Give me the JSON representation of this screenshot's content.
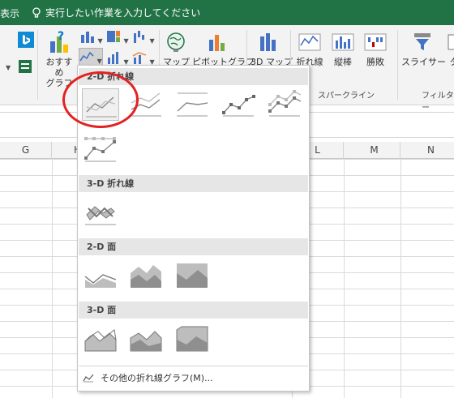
{
  "titlebar": {
    "view_tab": "表示",
    "tell_me": "実行したい作業を入力してください"
  },
  "ribbon": {
    "recommended_charts": "おすすめ\nグラフ",
    "maps": "マップ",
    "pivot_chart": "ピボットグラフ",
    "map_3d": "3D マップ",
    "sparkline_line": "折れ線",
    "sparkline_column": "縦棒",
    "sparkline_winloss": "勝敗",
    "slicer": "スライサー",
    "timeline": "タ",
    "group_sparklines": "スパークライン",
    "group_filter": "フィルター"
  },
  "columns": [
    "G",
    "H",
    "I",
    "J",
    "K",
    "L",
    "M",
    "N"
  ],
  "dropdown": {
    "sections": {
      "line_2d": "2-D 折れ線",
      "line_3d": "3-D 折れ線",
      "area_2d": "2-D 面",
      "area_3d": "3-D 面"
    },
    "more_charts": "その他の折れ線グラフ(M)..."
  },
  "icons": {
    "tell_me": "lightbulb-icon",
    "bing": "bing-icon",
    "recommended": "recommended-charts-icon",
    "line_chart_menu": "line-chart-icon",
    "globe": "globe-icon",
    "more": "line-chart-small-icon"
  },
  "colors": {
    "accent": "#217346",
    "annotation": "#e32222"
  }
}
